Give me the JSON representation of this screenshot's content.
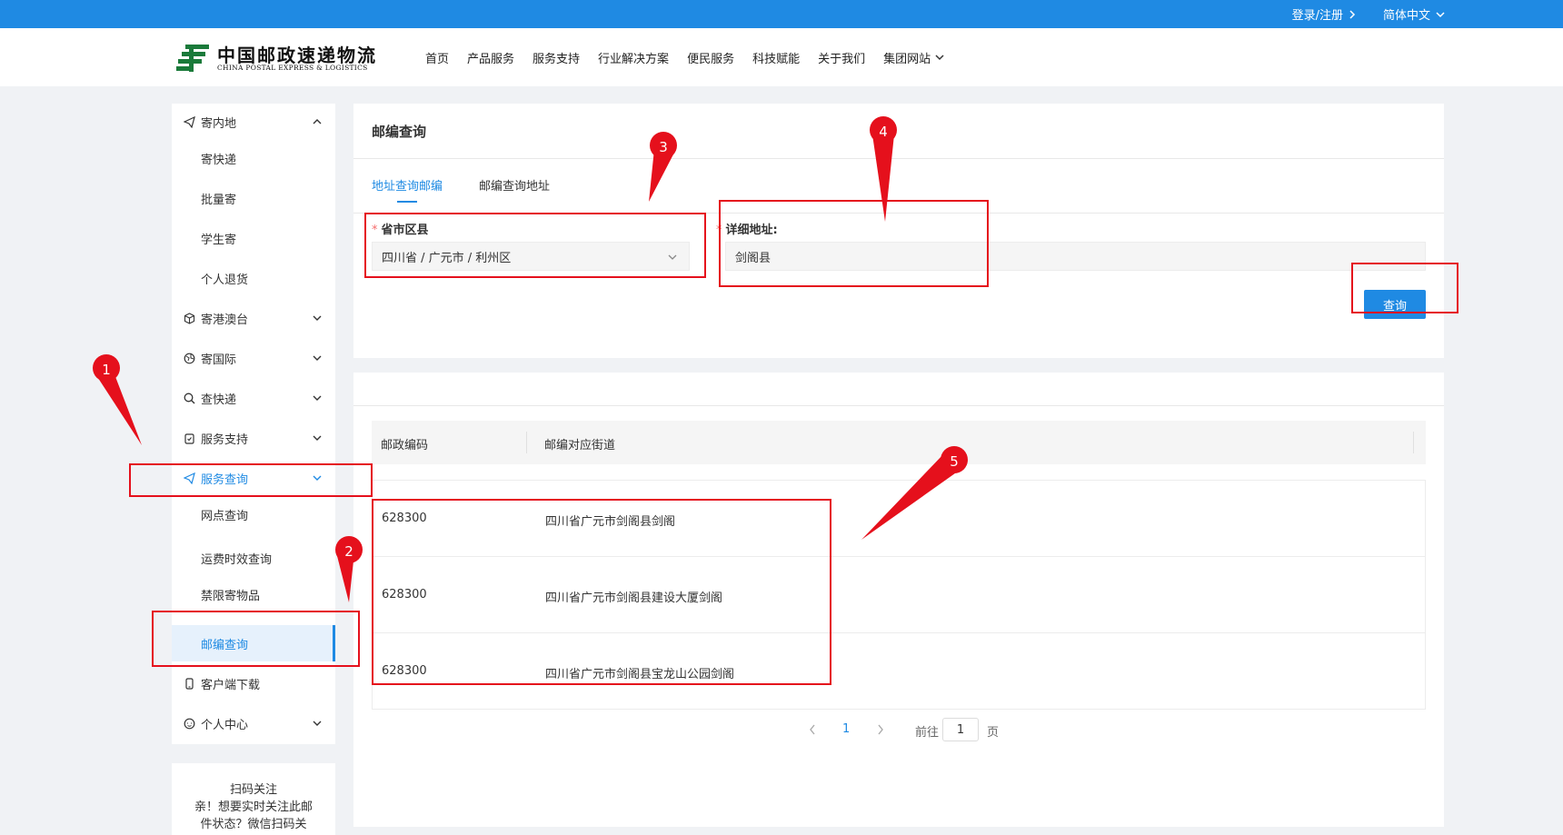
{
  "topbar": {
    "login": "登录/注册",
    "language": "简体中文"
  },
  "logo": {
    "cn": "中国邮政速递物流",
    "en": "CHINA POSTAL EXPRESS & LOGISTICS"
  },
  "nav": [
    "首页",
    "产品服务",
    "服务支持",
    "行业解决方案",
    "便民服务",
    "科技赋能",
    "关于我们",
    "集团网站"
  ],
  "sidebar": {
    "items": [
      {
        "label": "寄内地",
        "icon": "send-icon",
        "expanded": true
      },
      {
        "label": "寄快递"
      },
      {
        "label": "批量寄"
      },
      {
        "label": "学生寄"
      },
      {
        "label": "个人退货"
      },
      {
        "label": "寄港澳台",
        "icon": "box-icon"
      },
      {
        "label": "寄国际",
        "icon": "globe-icon"
      },
      {
        "label": "查快递",
        "icon": "search-icon"
      },
      {
        "label": "服务支持",
        "icon": "clipboard-icon"
      },
      {
        "label": "服务查询",
        "icon": "send-icon",
        "expanded": true
      },
      {
        "label": "网点查询"
      },
      {
        "label": "运费时效查询"
      },
      {
        "label": "禁限寄物品"
      },
      {
        "label": "邮编查询",
        "active": true
      },
      {
        "label": "客户端下载",
        "icon": "phone-icon"
      },
      {
        "label": "个人中心",
        "icon": "user-icon"
      }
    ],
    "qr": {
      "title": "扫码关注",
      "line1": "亲！想要实时关注此邮",
      "line2": "件状态？微信扫码关"
    }
  },
  "panel": {
    "title": "邮编查询",
    "tabs": [
      "地址查询邮编",
      "邮编查询地址"
    ],
    "region_label": "省市区县",
    "region_value": "四川省 / 广元市 / 利州区",
    "address_label": "详细地址:",
    "address_value": "剑阁县",
    "query_button": "查询"
  },
  "results": {
    "headers": [
      "邮政编码",
      "邮编对应街道"
    ],
    "rows": [
      {
        "code": "628300",
        "street": "四川省广元市剑阁县剑阁"
      },
      {
        "code": "628300",
        "street": "四川省广元市剑阁县建设大厦剑阁"
      },
      {
        "code": "628300",
        "street": "四川省广元市剑阁县宝龙山公园剑阁"
      }
    ],
    "pagination": {
      "current": "1",
      "goto_label": "前往",
      "goto_value": "1",
      "page_suffix": "页"
    }
  },
  "annotations": [
    "1",
    "2",
    "3",
    "4",
    "5"
  ],
  "colors": {
    "accent": "#1f8ae3",
    "highlight": "#e5101c",
    "logo_green": "#1a7a3a"
  }
}
